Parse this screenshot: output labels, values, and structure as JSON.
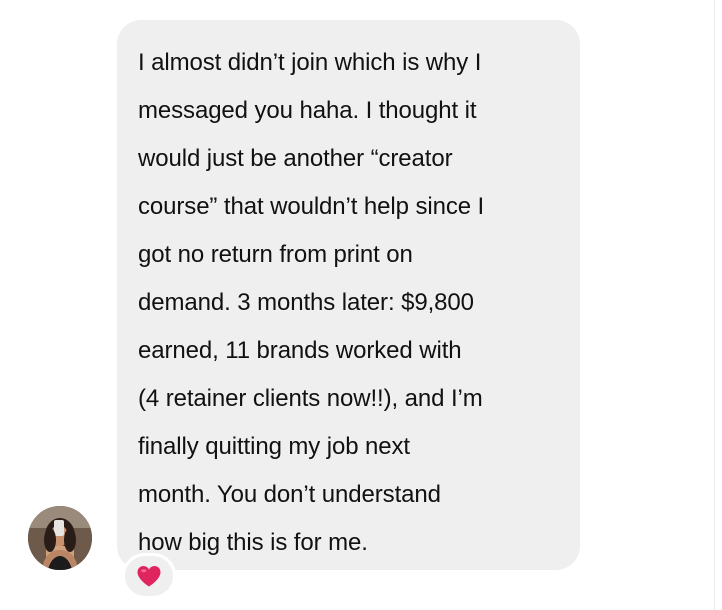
{
  "message": {
    "text": "I almost didn’t join which is why I\nmessaged you haha. I thought it\nwould just be another “creator\ncourse” that wouldn’t help since I\ngot no return from print on\ndemand. 3 months later: $9,800\nearned, 11 brands worked with\n(4 retainer clients now!!), and I’m\nfinally quitting my job next\nmonth. You don’t understand\nhow big this is for me.",
    "reaction_icon": "red-heart-icon"
  },
  "colors": {
    "bubble_background": "#efefef",
    "text": "#111111",
    "heart": "#e0245e"
  }
}
